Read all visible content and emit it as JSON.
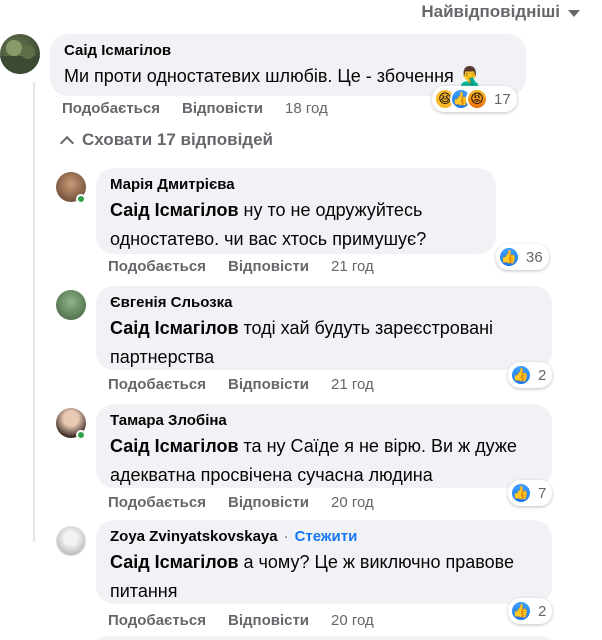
{
  "sort": {
    "label": "Найвідповідніші"
  },
  "main_comment": {
    "author": "Саід Ісмагілов",
    "text": "Ми проти одностатевих шлюбів. Це - збочення 🤦‍♂️",
    "like_label": "Подобається",
    "reply_label": "Відповісти",
    "time": "18 год",
    "reaction_count": "17"
  },
  "hide_replies": {
    "label": "Сховати 17 відповідей"
  },
  "replies": [
    {
      "author": "Марія Дмитрієва",
      "mention": "Саід Ісмагілов",
      "text": " ну то не одружуйтесь одностатево. чи вас хтось примушує?",
      "like_label": "Подобається",
      "reply_label": "Відповісти",
      "time": "21 год",
      "reaction_count": "36"
    },
    {
      "author": "Євгенія Сльозка",
      "mention": "Саід Ісмагілов",
      "text": " тоді хай будуть зареєстровані партнерства",
      "like_label": "Подобається",
      "reply_label": "Відповісти",
      "time": "21 год",
      "reaction_count": "2"
    },
    {
      "author": "Тамара Злобіна",
      "mention": "Саід Ісмагілов",
      "text": " та ну Саїде я не вірю. Ви ж дуже адекватна просвічена сучасна людина",
      "like_label": "Подобається",
      "reply_label": "Відповісти",
      "time": "20 год",
      "reaction_count": "7"
    },
    {
      "author": "Zoya Zvinyatskovskaya",
      "follow_label": "Стежити",
      "mention": "Саід Ісмагілов",
      "text": " а чому? Це ж виключно правове питання",
      "like_label": "Подобається",
      "reply_label": "Відповісти",
      "time": "20 год",
      "reaction_count": "2"
    }
  ],
  "colors": {
    "bubble": "#f0f2f5",
    "meta": "#65676b",
    "link": "#1877f2",
    "online": "#31a24c"
  },
  "icons": [
    "chevron-down-icon",
    "chevron-up-icon",
    "like-reaction-icon",
    "haha-reaction-icon",
    "angry-reaction-icon"
  ]
}
